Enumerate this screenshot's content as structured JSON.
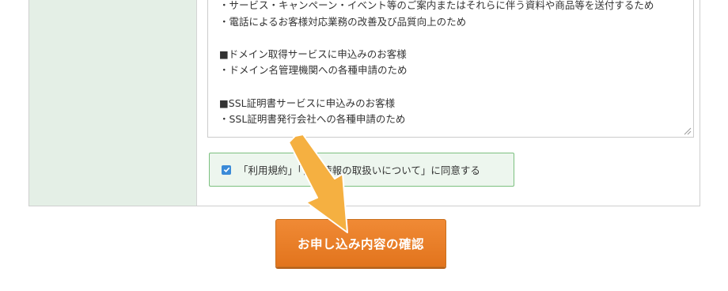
{
  "terms": {
    "lines": [
      "・サービス・キャンペーン・イベント等のご案内またはそれらに伴う資料や商品等を送付するため",
      "・電話によるお客様対応業務の改善及び品質向上のため",
      "",
      "■ドメイン取得サービスに申込みのお客様",
      "・ドメイン名管理機関への各種申請のため",
      "",
      "■SSL証明書サービスに申込みのお客様",
      "・SSL証明書発行会社への各種申請のため"
    ]
  },
  "agree": {
    "checked": true,
    "text": "「利用規約」「個人情報の取扱いについて」に同意する"
  },
  "submit": {
    "label": "お申し込み内容の確認"
  },
  "colors": {
    "label_column": "#e4efe6",
    "agree_border": "#7cc07f",
    "button": "#e97f28",
    "arrow": "#f5b041"
  }
}
